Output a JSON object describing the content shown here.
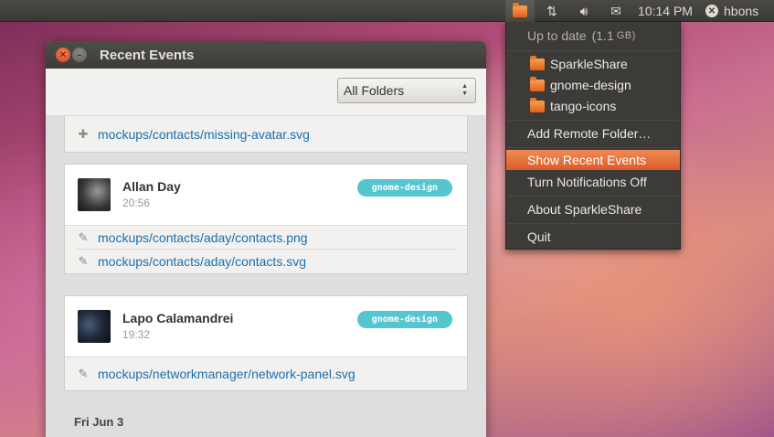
{
  "panel": {
    "clock": "10:14 PM",
    "user": "hbons",
    "icons": [
      "sparkleshare-icon",
      "network-icon",
      "volume-icon",
      "mail-icon",
      "session-icon"
    ]
  },
  "menu": {
    "status": "Up to date",
    "status_size": "(1.1",
    "status_unit": "GB)",
    "folders": [
      "SparkleShare",
      "gnome-design",
      "tango-icons"
    ],
    "add_remote": "Add Remote Folder…",
    "show_recent": "Show Recent Events",
    "notifications": "Turn Notifications Off",
    "about": "About SparkleShare",
    "quit": "Quit"
  },
  "window": {
    "title": "Recent Events",
    "folder_filter": "All Folders"
  },
  "events": [
    {
      "files": [
        {
          "icon": "add-icon",
          "path": "mockups/contacts/missing-avatar.svg"
        }
      ]
    },
    {
      "name": "Allan Day",
      "time": "20:56",
      "tag": "gnome-design",
      "files": [
        {
          "icon": "edit-icon",
          "path": "mockups/contacts/aday/contacts.png"
        },
        {
          "icon": "edit-icon",
          "path": "mockups/contacts/aday/contacts.svg"
        }
      ]
    },
    {
      "name": "Lapo Calamandrei",
      "time": "19:32",
      "tag": "gnome-design",
      "files": [
        {
          "icon": "edit-icon",
          "path": "mockups/networkmanager/network-panel.svg"
        }
      ]
    }
  ],
  "day_heading": "Fri Jun 3",
  "colors": {
    "accent_orange": "#dd5c2a",
    "tag_cyan": "#55c5cf",
    "link_blue": "#1b6fae"
  }
}
